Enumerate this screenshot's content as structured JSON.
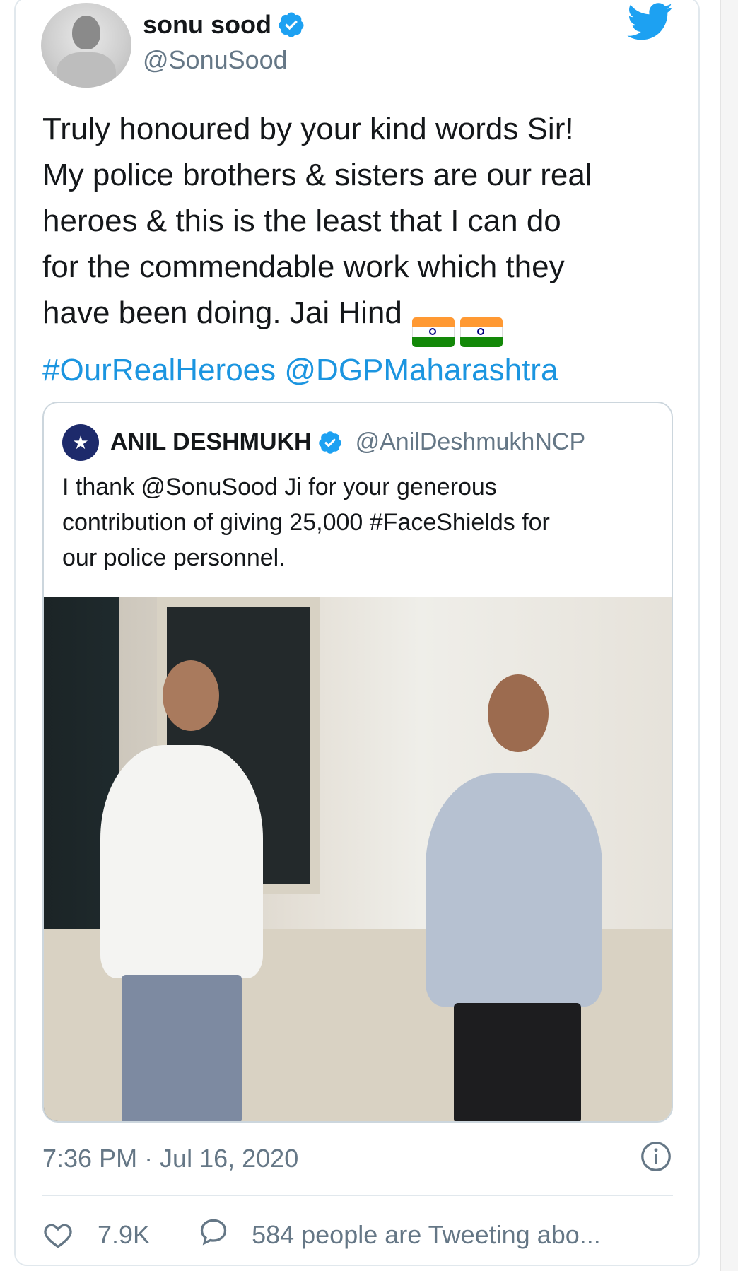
{
  "author": {
    "name": "sonu sood",
    "handle": "@SonuSood"
  },
  "tweet": {
    "lines": [
      "Truly honoured by your kind words Sir!",
      "My police brothers & sisters are our real",
      "heroes & this is the least that I can do",
      "for the commendable work which they",
      "have been doing. Jai Hind"
    ],
    "hashtag": "#OurRealHeroes",
    "mention": "@DGPMaharashtra"
  },
  "quoted": {
    "name": "ANIL DESHMUKH",
    "handle": "@AnilDeshmukhNCP",
    "text_lines": [
      "I thank @SonuSood Ji for your generous",
      "contribution of giving 25,000 #FaceShields for",
      "our police personnel."
    ]
  },
  "meta": {
    "timestamp": "7:36 PM · Jul 16, 2020"
  },
  "actions": {
    "likes": "7.9K",
    "tweeting": "584 people are Tweeting abo..."
  },
  "colors": {
    "link": "#1b95e0",
    "verified": "#1da1f2",
    "secondary_text": "#657786"
  },
  "icons": [
    "verified-badge-icon",
    "twitter-bird-icon",
    "info-icon",
    "heart-icon",
    "reply-bubble-icon",
    "india-flag-icon"
  ]
}
